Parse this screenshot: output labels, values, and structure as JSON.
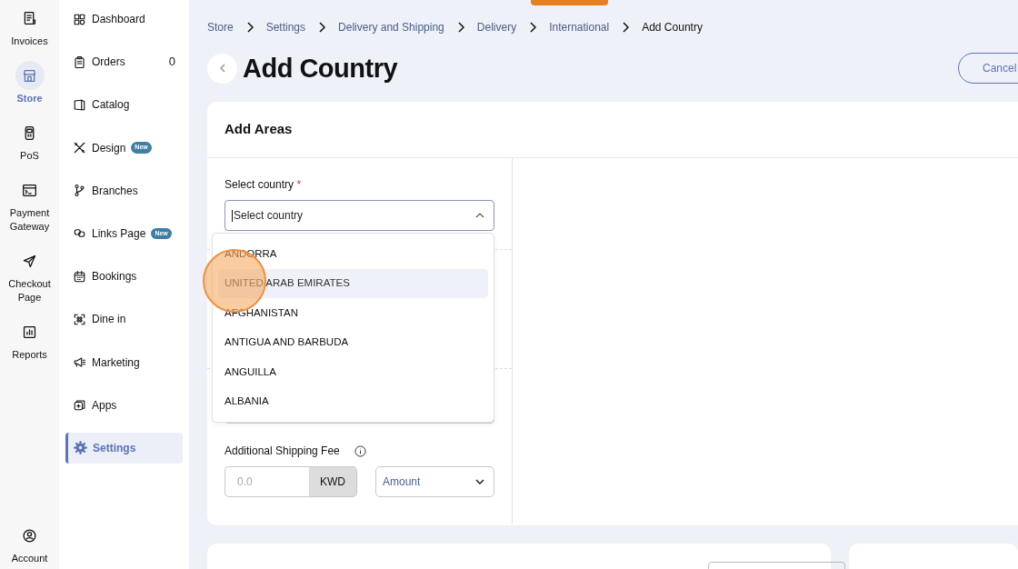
{
  "rail": [
    {
      "label": "Invoices",
      "selected": false
    },
    {
      "label": "Store",
      "selected": true
    },
    {
      "label": "PoS",
      "selected": false
    },
    {
      "label": "Payment Gateway",
      "selected": false
    },
    {
      "label": "Checkout Page",
      "selected": false
    },
    {
      "label": "Reports",
      "selected": false
    }
  ],
  "account": {
    "label": "Account"
  },
  "nav": [
    {
      "label": "Dashboard",
      "selected": false
    },
    {
      "label": "Orders",
      "selected": false,
      "count": "0"
    },
    {
      "label": "Catalog",
      "selected": false
    },
    {
      "label": "Design",
      "selected": false,
      "badge": "New"
    },
    {
      "label": "Branches",
      "selected": false
    },
    {
      "label": "Links Page",
      "selected": false,
      "badge": "New"
    },
    {
      "label": "Bookings",
      "selected": false
    },
    {
      "label": "Dine in",
      "selected": false
    },
    {
      "label": "Marketing",
      "selected": false
    },
    {
      "label": "Apps",
      "selected": false
    },
    {
      "label": "Settings",
      "selected": true
    }
  ],
  "breadcrumb": [
    "Store",
    "Settings",
    "Delivery and Shipping",
    "Delivery",
    "International",
    "Add Country"
  ],
  "title": "Add Country",
  "cancel_button": "Cancel",
  "card": {
    "title": "Add Areas",
    "country_field": {
      "label": "Select country",
      "required_mark": "*",
      "placeholder": "Select country",
      "expanded": true
    },
    "options": [
      {
        "label": "ANDORRA",
        "selected": false
      },
      {
        "label": "UNITED ARAB EMIRATES",
        "selected": true
      },
      {
        "label": "AFGHANISTAN",
        "selected": false
      },
      {
        "label": "ANTIGUA AND BARBUDA",
        "selected": false
      },
      {
        "label": "ANGUILLA",
        "selected": false
      },
      {
        "label": "ALBANIA",
        "selected": false
      }
    ],
    "fee": {
      "label": "Additional Shipping Fee",
      "placeholder": "0.0",
      "unit": "KWD",
      "type": "Amount"
    }
  }
}
